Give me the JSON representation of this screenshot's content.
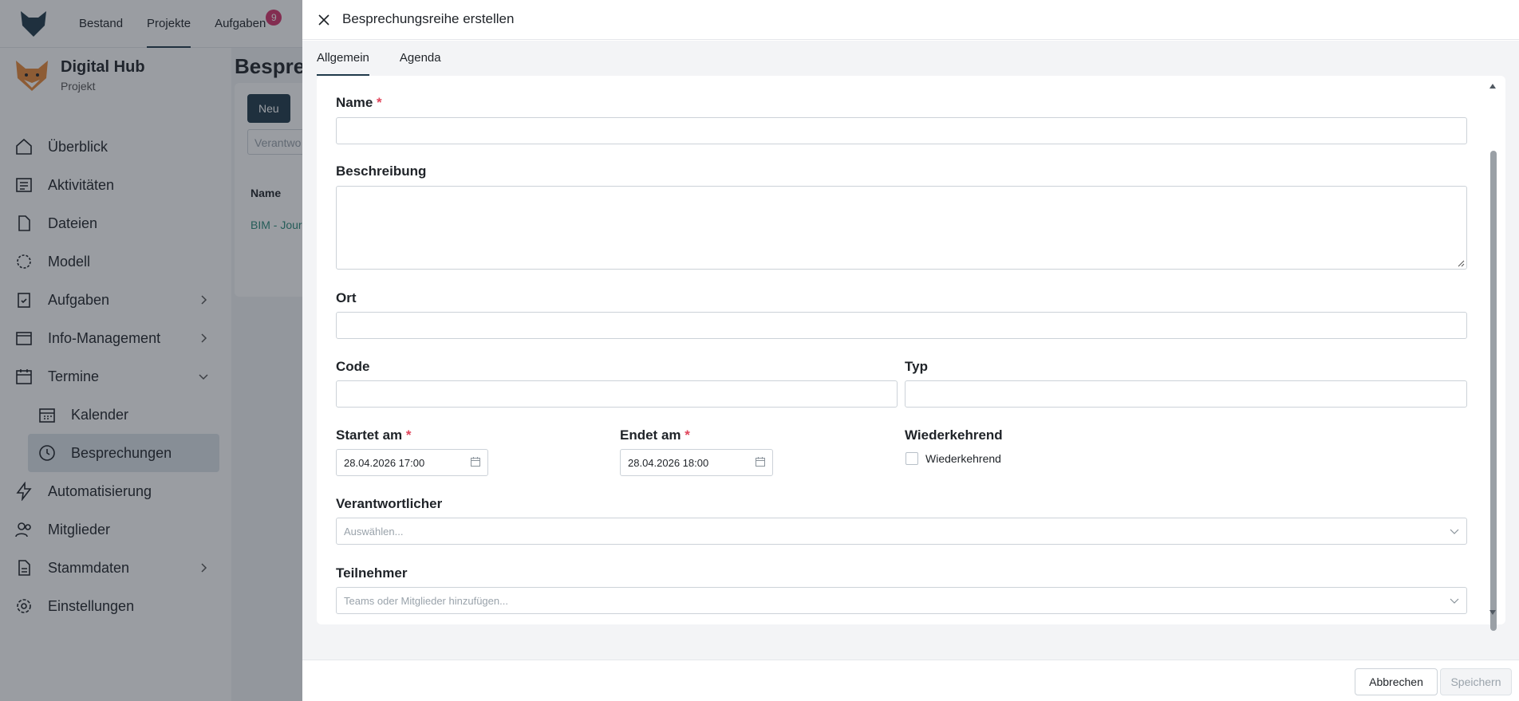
{
  "topnav": {
    "items": [
      {
        "label": "Bestand"
      },
      {
        "label": "Projekte"
      },
      {
        "label": "Aufgaben",
        "badge": "9"
      }
    ]
  },
  "project": {
    "name": "Digital Hub",
    "subtitle": "Projekt"
  },
  "sidebar": {
    "items": [
      {
        "label": "Überblick",
        "icon": "home-icon"
      },
      {
        "label": "Aktivitäten",
        "icon": "newspaper-icon"
      },
      {
        "label": "Dateien",
        "icon": "file-icon"
      },
      {
        "label": "Modell",
        "icon": "model-icon"
      },
      {
        "label": "Aufgaben",
        "icon": "clipboard-check-icon"
      },
      {
        "label": "Info-Management",
        "icon": "inbox-icon"
      },
      {
        "label": "Termine",
        "icon": "calendar-icon"
      },
      {
        "label": "Kalender",
        "icon": "calendar-grid-icon"
      },
      {
        "label": "Besprechungen",
        "icon": "clock-icon"
      },
      {
        "label": "Automatisierung",
        "icon": "lightning-icon"
      },
      {
        "label": "Mitglieder",
        "icon": "users-icon"
      },
      {
        "label": "Stammdaten",
        "icon": "document-icon"
      },
      {
        "label": "Einstellungen",
        "icon": "gear-icon"
      }
    ]
  },
  "main": {
    "title": "Besprec",
    "new_button": "Neu",
    "filter_placeholder": "Verantwo",
    "column_name": "Name",
    "row_link": "BIM - Jour"
  },
  "drawer": {
    "title": "Besprechungsreihe erstellen",
    "tabs": [
      {
        "label": "Allgemein"
      },
      {
        "label": "Agenda"
      }
    ],
    "fields": {
      "name_label": "Name",
      "description_label": "Beschreibung",
      "location_label": "Ort",
      "code_label": "Code",
      "type_label": "Typ",
      "starts_label": "Startet am",
      "starts_value": "28.04.2026 17:00",
      "ends_label": "Endet am",
      "ends_value": "28.04.2026 18:00",
      "recurring_label": "Wiederkehrend",
      "recurring_checkbox_label": "Wiederkehrend",
      "responsible_label": "Verantwortlicher",
      "responsible_placeholder": "Auswählen...",
      "participants_label": "Teilnehmer",
      "participants_placeholder": "Teams oder Mitglieder hinzufügen..."
    },
    "required_marker": "*",
    "cancel_button": "Abbrechen",
    "save_button": "Speichern"
  },
  "colors": {
    "accent": "#1f3a4a",
    "required": "#e0455b",
    "badge": "#d6336c",
    "link": "#2a8a7a"
  }
}
